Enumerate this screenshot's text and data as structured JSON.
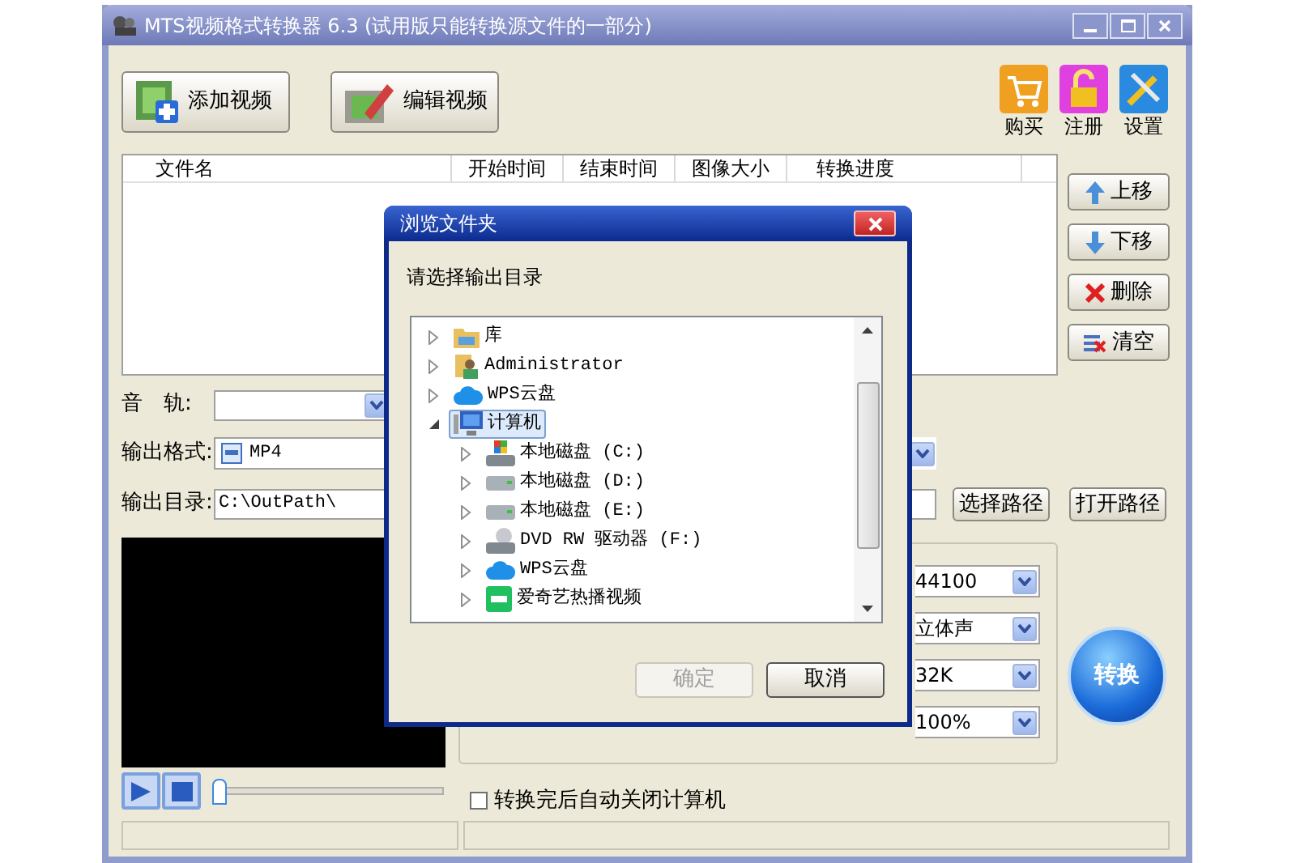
{
  "window": {
    "title": "MTS视频格式转换器 6.3 (试用版只能转换源文件的一部分)"
  },
  "toolbar": [
    {
      "label": "添加视频",
      "kind": "add"
    },
    {
      "label": "编辑视频",
      "kind": "edit"
    }
  ],
  "actions": [
    {
      "label": "购买",
      "kind": "cart"
    },
    {
      "label": "注册",
      "kind": "lock"
    },
    {
      "label": "设置",
      "kind": "tools"
    }
  ],
  "file_table": {
    "columns": [
      "文件名",
      "开始时间",
      "结束时间",
      "图像大小",
      "转换进度"
    ]
  },
  "list_buttons": [
    {
      "label": "上移",
      "kind": "up"
    },
    {
      "label": "下移",
      "kind": "down"
    },
    {
      "label": "删除",
      "kind": "delete"
    },
    {
      "label": "清空",
      "kind": "clear"
    }
  ],
  "audio_track": {
    "label": "音　轨:"
  },
  "output_format": {
    "label": "输出格式:",
    "value": "MP4"
  },
  "output_dir": {
    "label": "输出目录:",
    "value": "C:\\OutPath\\"
  },
  "path_buttons": [
    "选择路径",
    "打开路径"
  ],
  "settings_combos": [
    "44100",
    "立体声",
    "32K",
    "100%"
  ],
  "convert_button": "转换",
  "seek": {
    "level": 0
  },
  "auto_shutdown": {
    "label": "转换完后自动关闭计算机",
    "checked": false
  },
  "dialog": {
    "title": "浏览文件夹",
    "prompt": "请选择输出目录",
    "tree": [
      {
        "label": "库",
        "kind": "library",
        "expanded": false,
        "selected": false
      },
      {
        "label": "Administrator",
        "kind": "user",
        "expanded": false,
        "selected": false
      },
      {
        "label": "WPS云盘",
        "kind": "cloud",
        "expanded": false,
        "selected": false
      },
      {
        "label": "计算机",
        "kind": "computer",
        "expanded": true,
        "selected": true,
        "children": [
          {
            "label": "本地磁盘 (C:)",
            "kind": "sysdisk",
            "expanded": false,
            "selected": false
          },
          {
            "label": "本地磁盘 (D:)",
            "kind": "disk",
            "expanded": false,
            "selected": false
          },
          {
            "label": "本地磁盘 (E:)",
            "kind": "disk",
            "expanded": false,
            "selected": false
          },
          {
            "label": "DVD RW 驱动器 (F:)",
            "kind": "dvd",
            "expanded": false,
            "selected": false
          },
          {
            "label": "WPS云盘",
            "kind": "cloud",
            "expanded": false,
            "selected": false
          },
          {
            "label": "爱奇艺热播视频",
            "kind": "app",
            "expanded": false,
            "selected": false
          }
        ]
      }
    ],
    "buttons": [
      {
        "label": "确定",
        "disabled": true
      },
      {
        "label": "取消",
        "disabled": false
      }
    ]
  }
}
